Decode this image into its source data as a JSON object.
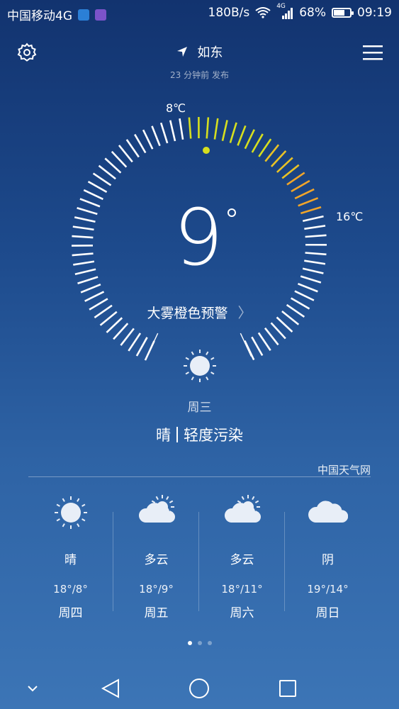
{
  "status": {
    "carrier": "中国移动4G",
    "speed": "180B/s",
    "net": "4G",
    "battery": "68%",
    "battery_level": 0.68,
    "time": "09:19"
  },
  "header": {
    "location": "如东",
    "updated": "23 分钟前 发布"
  },
  "current": {
    "temp": "9",
    "min": "8℃",
    "max": "16℃",
    "alert": "大雾橙色预警",
    "day": "周三",
    "weather": "晴",
    "air": "轻度污染"
  },
  "source": "中国天气网",
  "forecast": [
    {
      "cond": "晴",
      "range": "18°/8°",
      "day": "周四",
      "icon": "sun-icon"
    },
    {
      "cond": "多云",
      "range": "18°/9°",
      "day": "周五",
      "icon": "partly-cloudy-icon"
    },
    {
      "cond": "多云",
      "range": "18°/11°",
      "day": "周六",
      "icon": "partly-cloudy-icon"
    },
    {
      "cond": "阴",
      "range": "19°/14°",
      "day": "周日",
      "icon": "cloud-icon"
    }
  ],
  "colors": {
    "bg_top": "#12336f",
    "bg_bottom": "#3c75b6",
    "accent_green": "#d6df1f",
    "accent_orange": "#f0a52a"
  }
}
